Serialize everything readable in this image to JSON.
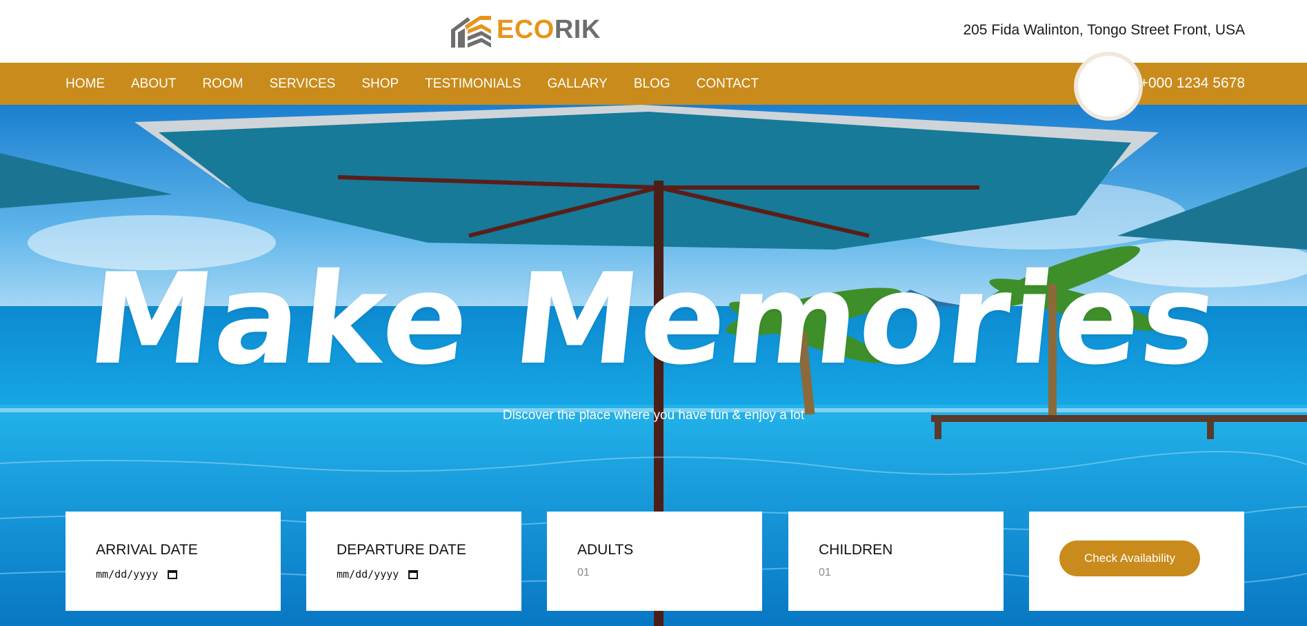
{
  "brand": {
    "name_part1": "ECO",
    "name_part2": "RIK",
    "accent_color": "#e8941a",
    "logo_icon": "house-roof-icon"
  },
  "header": {
    "address": "205 Fida Walinton, Tongo Street Front, USA"
  },
  "nav": {
    "items": [
      {
        "label": "HOME"
      },
      {
        "label": "ABOUT"
      },
      {
        "label": "ROOM"
      },
      {
        "label": "SERVICES"
      },
      {
        "label": "SHOP"
      },
      {
        "label": "TESTIMONIALS"
      },
      {
        "label": "GALLARY"
      },
      {
        "label": "BLOG"
      },
      {
        "label": "CONTACT"
      }
    ],
    "phone": "+000 1234 5678",
    "bar_color": "#c98b1c"
  },
  "hero": {
    "title": "Make Memories",
    "subtitle": "Discover the place where you have fun & enjoy a lot"
  },
  "booking": {
    "arrival": {
      "label": "ARRIVAL DATE",
      "placeholder": "mm/dd/yyyy"
    },
    "departure": {
      "label": "DEPARTURE DATE",
      "placeholder": "mm/dd/yyyy"
    },
    "adults": {
      "label": "ADULTS",
      "value": "01"
    },
    "children": {
      "label": "CHILDREN",
      "value": "01"
    },
    "check_button": "Check Availability"
  }
}
